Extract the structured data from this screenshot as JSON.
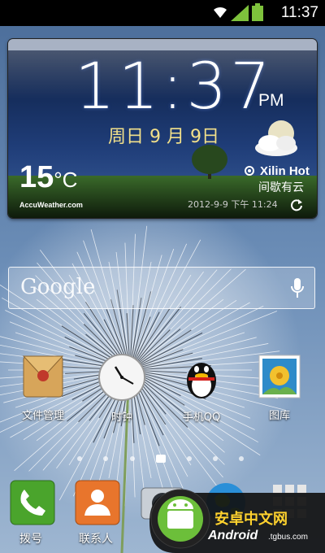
{
  "status_bar": {
    "time": "11:37"
  },
  "clock_widget": {
    "time": "11:37",
    "ampm": "PM",
    "date": "周日 9 月 9日",
    "temperature": "15",
    "temperature_unit": "°C",
    "brand": "AccuWeather.com",
    "location": "Xilin Hot",
    "condition": "间歇有云",
    "updated": "2012-9-9 下午 11:24"
  },
  "search_bar": {
    "logo": "Google"
  },
  "apps": [
    {
      "label": "文件管理",
      "icon": "file-manager-icon"
    },
    {
      "label": "时钟",
      "icon": "clock-icon"
    },
    {
      "label": "手机QQ",
      "icon": "qq-penguin-icon"
    },
    {
      "label": "图库",
      "icon": "gallery-icon"
    }
  ],
  "dock": [
    {
      "label": "拨号",
      "icon": "phone-icon"
    },
    {
      "label": "联系人",
      "icon": "contacts-icon"
    },
    {
      "label": "",
      "icon": "camera-icon"
    },
    {
      "label": "",
      "icon": "globe-icon"
    },
    {
      "label": "",
      "icon": "app-drawer-icon"
    }
  ],
  "watermark": {
    "line1": "安卓中文网",
    "line2": "Android",
    "line3": ".tgbus.com"
  },
  "colors": {
    "status_bar": "#000000",
    "date_text": "#f2e08a",
    "widget_sky": "#0a1a3a"
  }
}
